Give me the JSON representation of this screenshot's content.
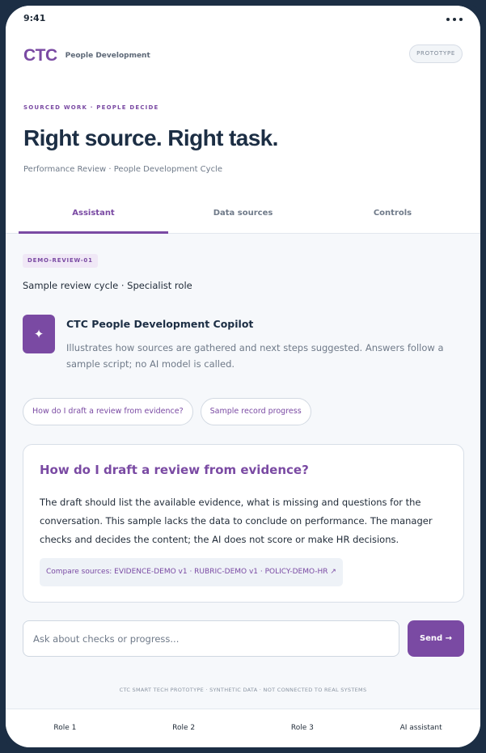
{
  "status_bar": {
    "time": "9:41"
  },
  "header": {
    "brand": "CTC",
    "brand_subtitle": "People Development",
    "badge": "PROTOTYPE"
  },
  "hero": {
    "eyebrow": "SOURCED WORK · PEOPLE DECIDE",
    "title": "Right source. Right task.",
    "subtitle": "Performance Review · People Development Cycle"
  },
  "tabs": [
    {
      "label": "Assistant",
      "active": true
    },
    {
      "label": "Data sources",
      "active": false
    },
    {
      "label": "Controls",
      "active": false
    }
  ],
  "case": {
    "tag": "DEMO-REVIEW-01",
    "description": "Sample review cycle · Specialist role"
  },
  "assistant": {
    "icon": "sparkle-icon",
    "name": "CTC People Development Copilot",
    "description": "Illustrates how sources are gathered and next steps suggested. Answers follow a sample script; no AI model is called."
  },
  "suggestions": [
    "How do I draft a review from evidence?",
    "Sample record progress"
  ],
  "answer": {
    "question": "How do I draft a review from evidence?",
    "body": "The draft should list the available evidence, what is missing and questions for the conversation. This sample lacks the data to conclude on performance. The manager checks and decides the content; the AI does not score or make HR decisions.",
    "sources": "Compare sources: EVIDENCE-DEMO v1 · RUBRIC-DEMO v1 · POLICY-DEMO-HR ↗"
  },
  "composer": {
    "placeholder": "Ask about checks or progress...",
    "send_label": "Send →"
  },
  "footer_note": "CTC SMART TECH PROTOTYPE · SYNTHETIC DATA · NOT CONNECTED TO REAL SYSTEMS",
  "bottom_nav": [
    "Role 1",
    "Role 2",
    "Role 3",
    "AI assistant"
  ],
  "colors": {
    "accent": "#7a4aa3",
    "frame": "#1c2e44",
    "background": "#f6f8fb"
  }
}
